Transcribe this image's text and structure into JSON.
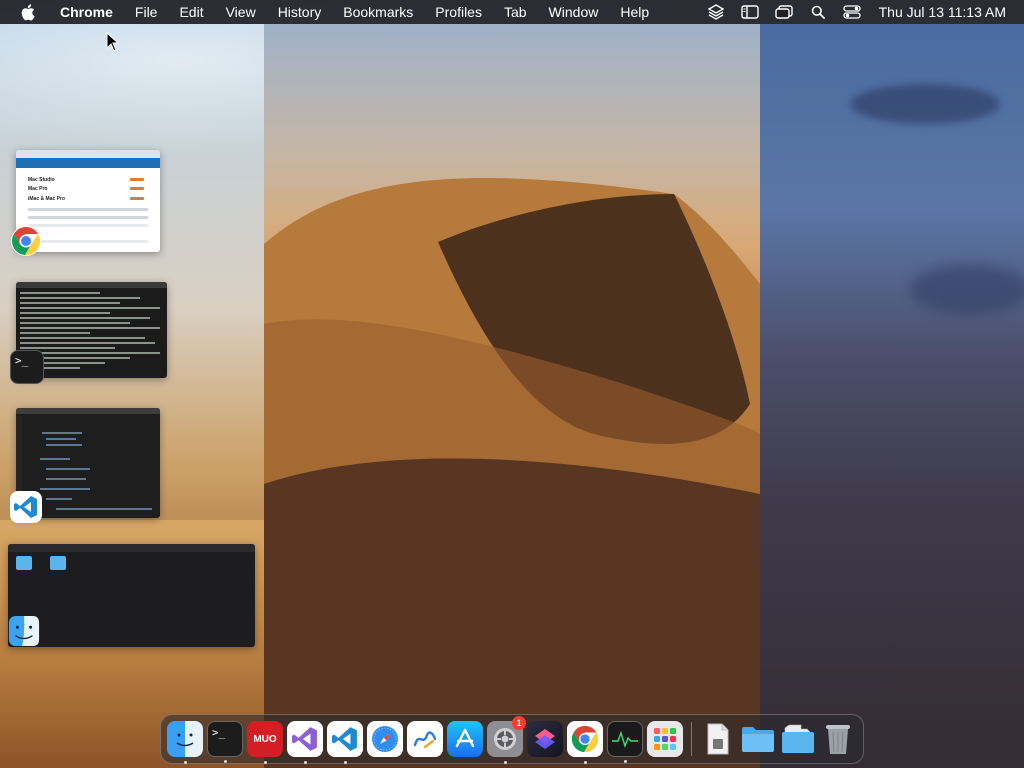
{
  "menubar": {
    "app_name": "Chrome",
    "menus": [
      "File",
      "Edit",
      "View",
      "History",
      "Bookmarks",
      "Profiles",
      "Tab",
      "Window",
      "Help"
    ],
    "status_icons": [
      "layers-icon",
      "sidebar-icon",
      "windows-icon",
      "search-icon",
      "control-center-icon"
    ],
    "clock": "Thu Jul 13  11:13 AM"
  },
  "thumbnails": {
    "chrome": {
      "app": "chrome-icon",
      "rows": [
        "Mac Studio",
        "Mac Pro",
        "iMac & Mac Pro"
      ]
    },
    "terminal": {
      "app": "terminal-icon",
      "prompt": ">_"
    },
    "vscode": {
      "app": "vscode-icon"
    },
    "finder": {
      "app": "finder-icon"
    }
  },
  "dock": {
    "items": [
      {
        "name": "finder-icon",
        "running": true
      },
      {
        "name": "terminal-icon",
        "running": true,
        "label": ">_"
      },
      {
        "name": "muo-icon",
        "running": true,
        "label": "MUO"
      },
      {
        "name": "visual-studio-icon",
        "running": true
      },
      {
        "name": "vscode-icon",
        "running": true
      },
      {
        "name": "safari-icon",
        "running": false
      },
      {
        "name": "freeform-icon",
        "running": false
      },
      {
        "name": "app-store-icon",
        "running": false
      },
      {
        "name": "system-settings-icon",
        "running": true,
        "badge": "1"
      },
      {
        "name": "shortcuts-icon",
        "running": false
      },
      {
        "name": "chrome-icon",
        "running": true
      },
      {
        "name": "activity-monitor-icon",
        "running": true
      },
      {
        "name": "launchpad-icon",
        "running": false
      }
    ],
    "trailing": [
      {
        "name": "document-icon"
      },
      {
        "name": "folder-icon"
      },
      {
        "name": "downloads-folder-icon"
      },
      {
        "name": "trash-icon"
      }
    ]
  },
  "colors": {
    "menubar": "#1e1e24",
    "accent": "#1f6fb5",
    "badge": "#ff3b30"
  }
}
